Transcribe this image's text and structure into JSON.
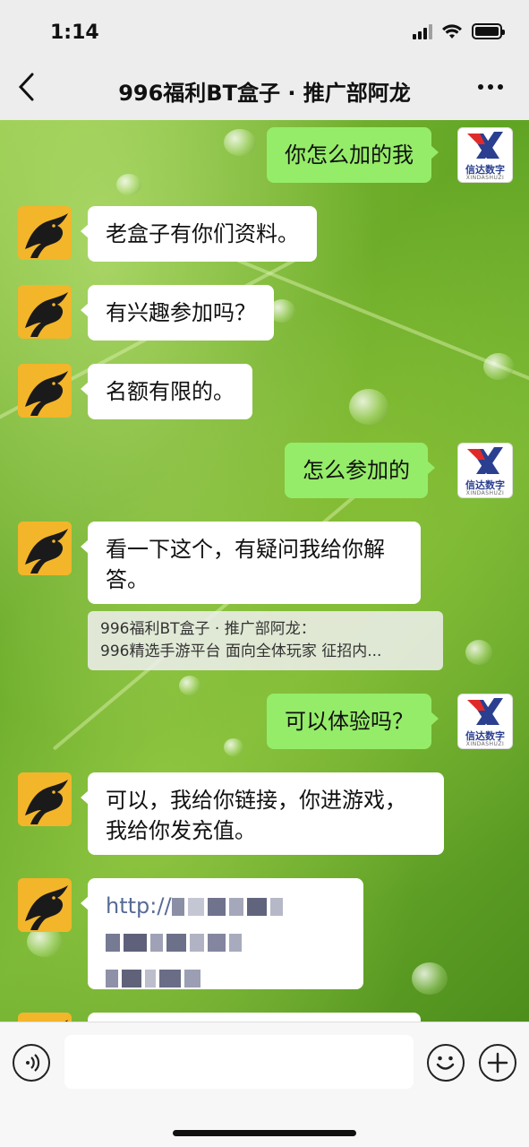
{
  "status_bar": {
    "time": "1:14"
  },
  "nav": {
    "back_icon": "chevron-left-icon",
    "title": "996福利BT盒子 · 推广部阿龙",
    "more_icon": "more-dots-icon"
  },
  "contact_avatar": {
    "icon": "dragon-avatar-icon",
    "bg": "#f3b52a"
  },
  "self_avatar": {
    "brand_cn": "信达数字",
    "brand_en": "XINDASHUZI",
    "logo_colors": [
      "#e02a2a",
      "#2a3f8f"
    ]
  },
  "messages": [
    {
      "side": "out",
      "text": "你怎么加的我"
    },
    {
      "side": "in",
      "text": "老盒子有你们资料。"
    },
    {
      "side": "in",
      "text": "有兴趣参加吗？"
    },
    {
      "side": "in",
      "text": "名额有限的。"
    },
    {
      "side": "out",
      "text": "怎么参加的"
    },
    {
      "side": "in",
      "text": "看一下这个，有疑问我给你解答。"
    },
    {
      "side": "out",
      "text": "可以体验吗？"
    },
    {
      "side": "in",
      "text": "可以，我给你链接，你进游戏，我给你发充值。"
    },
    {
      "side": "in",
      "text": "http://"
    }
  ],
  "quote": {
    "line1": "996福利BT盒子 · 推广部阿龙：",
    "line2": "996精选手游平台 面向全体玩家 征招内..."
  },
  "input_bar": {
    "voice_icon": "voice-icon",
    "emoji_icon": "emoji-icon",
    "plus_icon": "plus-icon"
  },
  "colors": {
    "out_bubble": "#95ec69",
    "in_bubble": "#ffffff",
    "link": "#576b95"
  }
}
